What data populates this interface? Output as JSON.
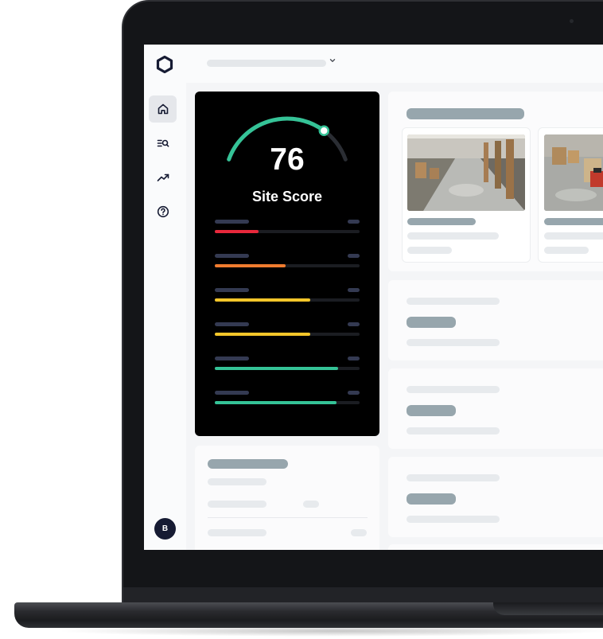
{
  "sidebar": {
    "logo_icon": "hexagon-logo-icon",
    "items": [
      {
        "name": "home",
        "icon": "home-icon",
        "active": true
      },
      {
        "name": "search-list",
        "icon": "search-list-icon",
        "active": false
      },
      {
        "name": "trends",
        "icon": "trending-up-icon",
        "active": false
      },
      {
        "name": "help",
        "icon": "help-circle-icon",
        "active": false
      }
    ],
    "avatar_initial": "B"
  },
  "header": {
    "site_selector_icon": "chevron-down-icon"
  },
  "score_card": {
    "score": "76",
    "label": "Site Score",
    "gauge_fraction": 0.76,
    "colors": {
      "gauge": "#35c397",
      "gauge_track": "#2a2d33",
      "background": "#000000"
    },
    "metrics": [
      {
        "fraction": 0.3,
        "color": "#e8283b"
      },
      {
        "fraction": 0.49,
        "color": "#f07c2f"
      },
      {
        "fraction": 0.66,
        "color": "#f4c62a"
      },
      {
        "fraction": 0.66,
        "color": "#f4c62a"
      },
      {
        "fraction": 0.85,
        "color": "#35c397"
      },
      {
        "fraction": 0.84,
        "color": "#35c397"
      }
    ]
  },
  "camera_feeds": [
    {
      "icon": "warehouse-aisle-camera-image"
    },
    {
      "icon": "warehouse-forklift-camera-image"
    }
  ]
}
